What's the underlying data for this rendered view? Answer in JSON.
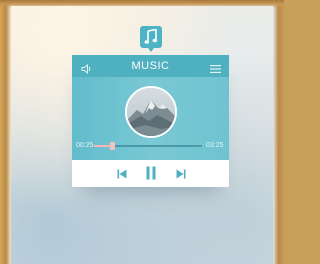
{
  "player": {
    "title": "MUSIC",
    "time_elapsed": "00:25",
    "time_total": "03:25",
    "progress": 0.17
  },
  "icons": {
    "app": "music-note-icon",
    "volume": "speaker-icon",
    "menu": "hamburger-menu-icon",
    "previous": "skip-previous-icon",
    "pause": "pause-icon",
    "next": "skip-next-icon"
  },
  "colors": {
    "accent": "#4fb0c0",
    "progress_knob": "#f5c2c2",
    "controls_bg": "#ffffff"
  }
}
